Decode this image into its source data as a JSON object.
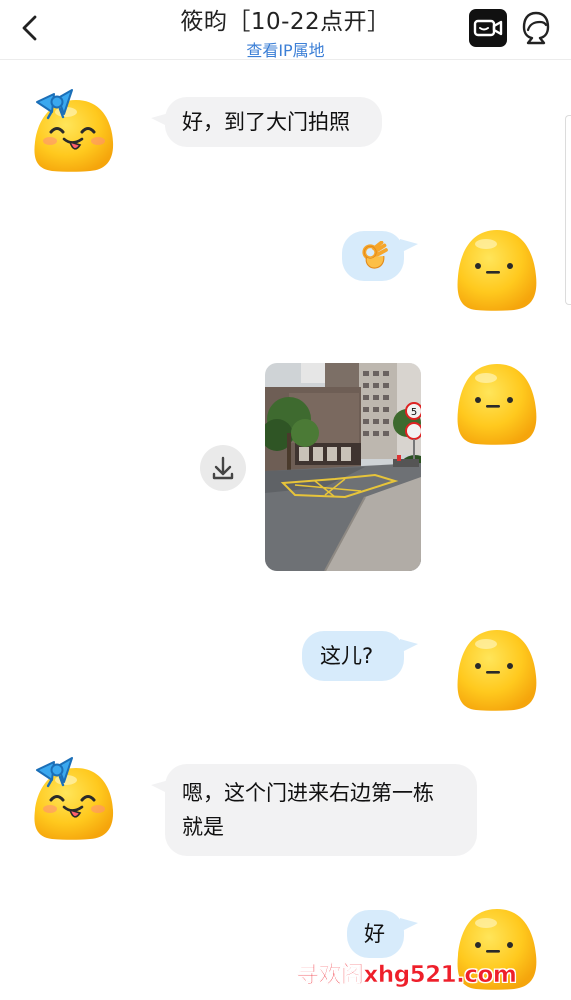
{
  "header": {
    "title": "筱昀［10-22点开］",
    "ip_link": "查看IP属地",
    "back_icon": "chevron-left-icon",
    "video_icon": "video-call-icon",
    "profile_icon": "profile-icon"
  },
  "messages": [
    {
      "side": "left",
      "text": "好，到了大门拍照",
      "sender_avatar": "girl-bow-avatar"
    },
    {
      "side": "right",
      "emoji": "ok-hand-emoji",
      "sender_avatar": "yellow-blob-avatar"
    },
    {
      "side": "right",
      "type": "photo",
      "photo_subject": "street-photo",
      "sender_avatar": "yellow-blob-avatar",
      "speed_sign_number": "5"
    },
    {
      "side": "right",
      "text": "这儿?",
      "sender_avatar": "yellow-blob-avatar"
    },
    {
      "side": "left",
      "text": "嗯，这个门进来右边第一栋\n就是",
      "sender_avatar": "girl-bow-avatar"
    },
    {
      "side": "right",
      "text": "好",
      "sender_avatar": "yellow-blob-avatar"
    }
  ],
  "watermark": "寻欢阁xhg521.com",
  "colors": {
    "left_bubble": "#f2f2f3",
    "right_bubble": "#d7ebfb",
    "ip_link": "#3c7fd6",
    "avatar_yellow": "#ffc91e",
    "watermark": "#ee1f2a"
  }
}
